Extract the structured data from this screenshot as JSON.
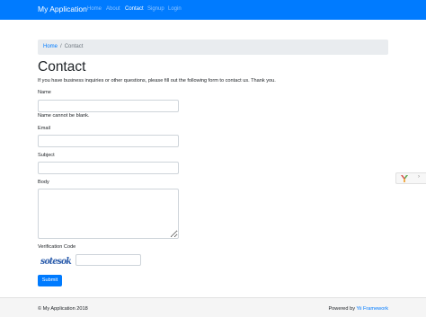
{
  "navbar": {
    "brand": "My Application",
    "items": [
      {
        "label": "Home",
        "active": false
      },
      {
        "label": "About",
        "active": false
      },
      {
        "label": "Contact",
        "active": true
      },
      {
        "label": "Signup",
        "active": false
      },
      {
        "label": "Login",
        "active": false
      }
    ]
  },
  "breadcrumb": {
    "home": "Home",
    "separator": "/",
    "current": "Contact"
  },
  "page": {
    "title": "Contact",
    "intro": "If you have business inquiries or other questions, please fill out the following form to contact us. Thank you."
  },
  "form": {
    "name_label": "Name",
    "name_value": "",
    "name_error": "Name cannot be blank.",
    "email_label": "Email",
    "email_value": "",
    "subject_label": "Subject",
    "subject_value": "",
    "body_label": "Body",
    "body_value": "",
    "verification_label": "Verification Code",
    "captcha_text": "sotesok",
    "verification_value": "",
    "submit_label": "Submit"
  },
  "footer": {
    "copyright": "© My Application 2018",
    "powered_prefix": "Powered by ",
    "powered_link": "Yii Framework"
  },
  "debug_toolbar": {
    "close_glyph": "›"
  },
  "colors": {
    "primary": "#007bff",
    "breadcrumb_bg": "#e9ecef",
    "footer_bg": "#f5f5f5",
    "captcha_ink": "#2b5cab"
  }
}
